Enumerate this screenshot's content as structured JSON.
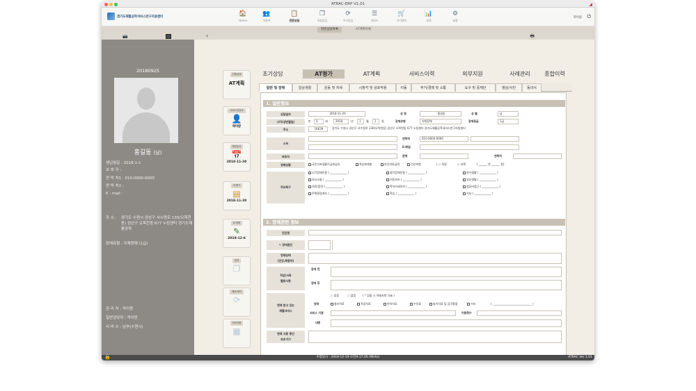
{
  "window": {
    "title": "ATRAC-ERP V1.01"
  },
  "header": {
    "logo_text": "경기도재활공학서비스연구지원센터",
    "user": "곽이랑",
    "nav": [
      {
        "label": "Home",
        "icon": "home-icon",
        "glyph": "🏠"
      },
      {
        "label": "이용자",
        "icon": "users-icon",
        "glyph": "👥"
      },
      {
        "label": "전문상담",
        "icon": "document-icon",
        "glyph": "📋"
      },
      {
        "label": "지원상담",
        "icon": "copy-icon",
        "glyph": "❐"
      },
      {
        "label": "수리상담",
        "icon": "refresh-icon",
        "glyph": "⟳"
      },
      {
        "label": "서비스",
        "icon": "list-icon",
        "glyph": "☰"
      },
      {
        "label": "기기관리",
        "icon": "cart-icon",
        "glyph": "🛒"
      },
      {
        "label": "실적",
        "icon": "chart-icon",
        "glyph": "📊"
      },
      {
        "label": "설정",
        "icon": "gear-icon",
        "glyph": "⚙"
      }
    ]
  },
  "subtabs": [
    "전문상담목록",
    "AT계획목록"
  ],
  "patient": {
    "date": "20180925",
    "name": "홍길동",
    "sex": "(남)",
    "birth_label": "생년월일 :",
    "birth": "2018-1-1",
    "guardian_label": "보 호 자 :",
    "guardian": "",
    "phone1_label": "연 락 처1 :",
    "phone1": "010-0000-0000",
    "phone2_label": "연 락 처2 :",
    "phone2": "",
    "email_label": "E - mail :",
    "email": "",
    "address_label": "주    소 :",
    "address": "경기도 수원시 권선구 서수원로 130(오목천동) 권선구 오목천동 677 누림센터 경기도재활공학",
    "disability_label": "장애유형 :",
    "disability": "지체장애 (1급)",
    "manager_label": "관 리 자 :",
    "manager": "곽이랑",
    "staff_label": "일반담당자 :",
    "staff": "곽이랑",
    "service_label": "서 비 스 :",
    "service": "남부(수원시)"
  },
  "steps": [
    {
      "tag": "진행상태",
      "main": "AT계획",
      "date": "",
      "glyph": "",
      "icon": ""
    },
    {
      "tag": "서비스담당자",
      "main": "",
      "date": "곽이랑",
      "glyph": "👤",
      "icon": "person-icon"
    },
    {
      "tag": "해당일자",
      "main": "",
      "date": "2018-11-20",
      "glyph": "📅",
      "icon": "calendar-icon"
    },
    {
      "tag": "AT평가",
      "main": "",
      "date": "2018-11-20",
      "glyph": "▤",
      "icon": "notebook-icon"
    },
    {
      "tag": "AT계획",
      "main": "",
      "date": "2018-12-6",
      "glyph": "✎",
      "icon": "edit-icon"
    },
    {
      "tag": "대여",
      "main": "",
      "date": "",
      "glyph": "❐",
      "icon": "rental-icon"
    },
    {
      "tag": "제조/제작",
      "main": "",
      "date": "",
      "glyph": "⟳",
      "icon": "manufacture-icon"
    },
    {
      "tag": "외부지원",
      "main": "",
      "date": "",
      "glyph": "▦",
      "icon": "external-support-icon"
    }
  ],
  "main_tabs": [
    "초기상담",
    "AT평가",
    "AT계획",
    "서비스이력",
    "외부지원",
    "사례관리",
    "종합이력"
  ],
  "sub_tabs": [
    "일반 및 장애",
    "일상생활",
    "운동 및 자세",
    "시청각 및 상호작용",
    "이동",
    "주거/경제 및 소통",
    "요구 및 중재안",
    "영상/사진",
    "동의서"
  ],
  "form": {
    "section1": "1. 일반정보",
    "consult_date_label": "상담일자",
    "consult_date": "2018-11-20",
    "name_label": "성 명",
    "name": "홍길동",
    "sex_label": "성 별",
    "sex": "남",
    "age_label": "나이(생년월일)",
    "age_prefix": "만",
    "age": "0",
    "age_unit": "세",
    "birth_year": "2018",
    "year_unit": "년",
    "birth_month": "1",
    "month_unit": "월",
    "birth_day": "1",
    "day_unit": "일",
    "disability_type_label": "장애유형",
    "disability_type": "지체장애",
    "disability_grade_label": "장애등급",
    "disability_grade": "1급",
    "address_label": "주소",
    "zip": "16639",
    "address": "경기도 수원시 권선구 서수원로 130(오목천동) 권선구 오목천동 677 누림센터 경기도재활공학서비스연구지원센터",
    "affiliation_label": "소속",
    "contact_label": "연락처",
    "contact": "010-0000-0000",
    "email_label": "E-메일",
    "guardian_label": "보호자",
    "relation_label": "관계",
    "guardian_contact_label": "연락처",
    "economy_label": "경제상황",
    "economy_options": [
      "국민기초생활수급대상자",
      "차상위계층",
      "본인의료급여",
      "건강보험"
    ],
    "job_options": [
      "직장",
      "자택"
    ],
    "income_unit": "만",
    "won_unit": "원)",
    "needs_label": "주요욕구",
    "needs": [
      "시각장애인용",
      "청각장애인용",
      "여가생활",
      "의사소통",
      "이동보조",
      "일상생활",
      "치료/훈련",
      "학석자세유지",
      "컴퓨터접근",
      "주택환경개조",
      "학습",
      "기타"
    ],
    "section2": "2. 장애관련 정보",
    "diagnosis_label": "진단명",
    "cause_label": "장애원인",
    "current_label": "현재상태\n(건강,복용약)",
    "job_label": "직업/사회\n활동사항",
    "before_label": "장애 전",
    "after_label": "장애 후",
    "rehab_label": "현재 받고 있는\n재활서비스",
    "yes_label": "있음",
    "no_label": "없음",
    "rehab_note": "( * 있을 시 아래사항 기술 )",
    "area_label": "영역",
    "therapy_options": [
      "물리치료",
      "작업치료",
      "언어치료",
      "수치료",
      "놀이치료 및 감각통합",
      "기타"
    ],
    "agency_label": "서비스 기관",
    "frequency_label": "이용횟수",
    "content_label": "내용",
    "device_label": "현재 사용 중인\n보조기기"
  },
  "status": {
    "modified": "수정일시 : 2018-12-19  오전9:17:26 (Write)",
    "version": "ATRAC Ver 1.01"
  }
}
